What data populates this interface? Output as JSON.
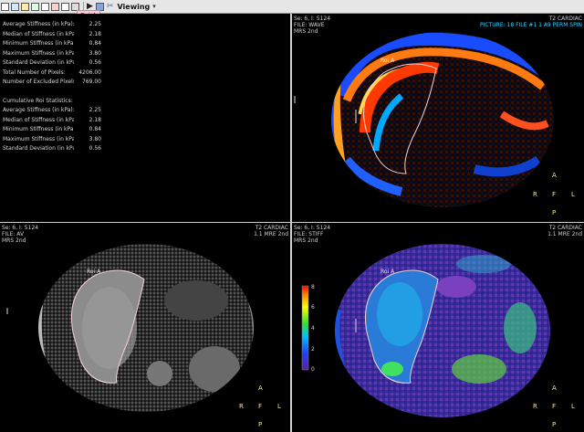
{
  "toolbar": {
    "roi_tab": "Roi A",
    "mode_label": "Viewing"
  },
  "stats_panel": {
    "current": [
      {
        "label": "Average Stiffness (in kPa):",
        "value": "2.25"
      },
      {
        "label": "Median of Stiffness (in kPa):",
        "value": "2.18"
      },
      {
        "label": "Minimum Stiffness (in kPa):",
        "value": "0.84"
      },
      {
        "label": "Maximum Stiffness (in kPa):",
        "value": "3.80"
      },
      {
        "label": "Standard Deviation (in kPa):",
        "value": "0.56"
      },
      {
        "label": "Total Number of Pixels:",
        "value": "4206.00"
      },
      {
        "label": "Number of Excluded Pixels:",
        "value": "769.00"
      }
    ],
    "cumulative_title": "Cumulative Roi Statistics:",
    "cumulative": [
      {
        "label": "Average Stiffness (in kPa):",
        "value": "2.25"
      },
      {
        "label": "Median of Stiffness (in kPa):",
        "value": "2.18"
      },
      {
        "label": "Minimum Stiffness (in kPa):",
        "value": "0.84"
      },
      {
        "label": "Maximum Stiffness (in kPa):",
        "value": "3.80"
      },
      {
        "label": "Standard Deviation (in kPa):",
        "value": "0.56"
      }
    ]
  },
  "viewports": {
    "top_right": {
      "series": "Se: 6, I: 5124",
      "fname": "FILE: WAVE",
      "mrs": "MRS 2nd",
      "header_right": "T2 CARDIAC",
      "header_right2": "PICTURE: 18 FILE #1 1 A9 PERM SPIN",
      "roi_label": "Roi A"
    },
    "bottom_left": {
      "series": "Se: 6, I: 5124",
      "fname": "FILE: AV",
      "mrs": "MRS 2nd",
      "header_right": "T2 CARDIAC",
      "header_right2": "1.1 MRE 2nd",
      "roi_label": "Roi A"
    },
    "bottom_right": {
      "series": "Se: 6, I: 5124",
      "fname": "FILE: STIFF",
      "mrs": "MRS 2nd",
      "header_right": "T2 CARDIAC",
      "header_right2": "1.1 MRE 2nd",
      "roi_label": "Roi A",
      "colorbar_ticks": [
        "8",
        "6",
        "4",
        "2",
        "0"
      ]
    }
  },
  "orientation": {
    "top": "A",
    "bottom": "P",
    "left": "R",
    "right": "L",
    "center": "F"
  },
  "colors": {
    "toolbar": "#e6e6e6",
    "separator": "#cfcfcf",
    "roi_outline": "#f3d3d8",
    "orient_text": "#f5e6a0"
  }
}
